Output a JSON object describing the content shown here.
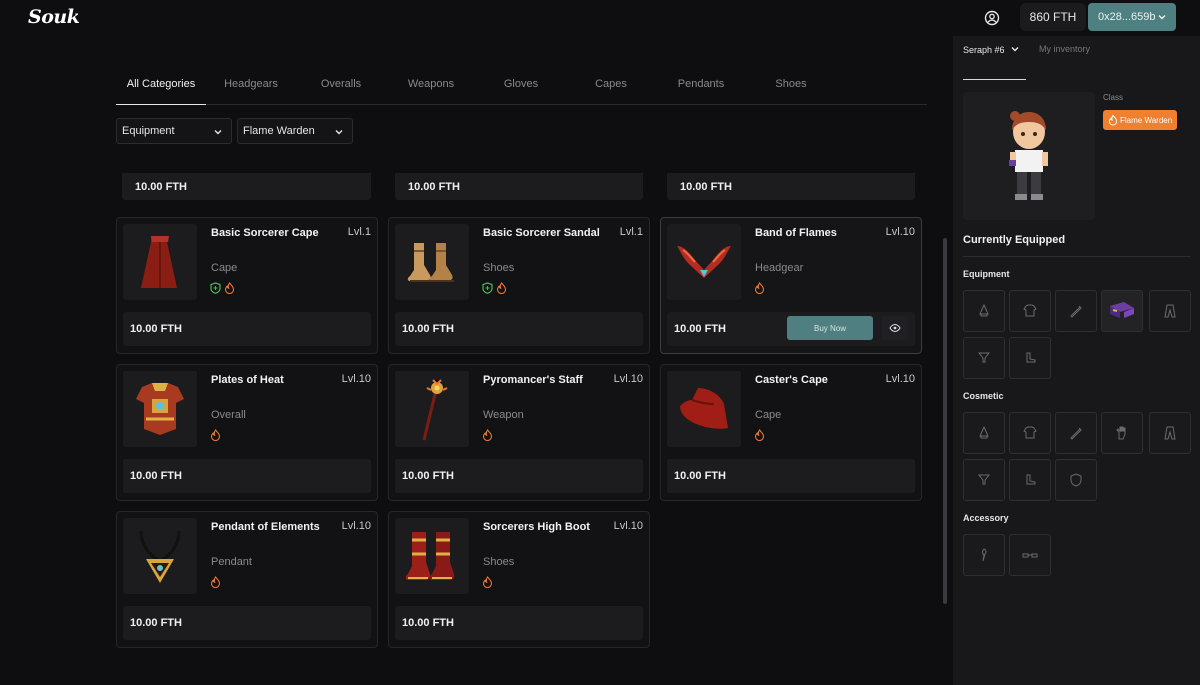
{
  "header": {
    "logo": "Souk",
    "balance": "860 FTH",
    "wallet": "0x28...659b"
  },
  "categories": {
    "tabs": [
      {
        "label": "All Categories",
        "active": true
      },
      {
        "label": "Headgears"
      },
      {
        "label": "Overalls"
      },
      {
        "label": "Weapons"
      },
      {
        "label": "Gloves"
      },
      {
        "label": "Capes"
      },
      {
        "label": "Pendants"
      },
      {
        "label": "Shoes"
      }
    ]
  },
  "filters": {
    "type": "Equipment",
    "class": "Flame Warden"
  },
  "partial_prices": [
    "10.00 FTH",
    "10.00 FTH",
    "10.00 FTH"
  ],
  "items": [
    {
      "name": "Basic Sorcerer Cape",
      "level": "Lvl.1",
      "type": "Cape",
      "price": "10.00 FTH",
      "icon": "red-cape-icon"
    },
    {
      "name": "Basic Sorcerer Sandal",
      "level": "Lvl.1",
      "type": "Shoes",
      "price": "10.00 FTH",
      "icon": "sandal-icon"
    },
    {
      "name": "Band of Flames",
      "level": "Lvl.10",
      "type": "Headgear",
      "price": "10.00 FTH",
      "icon": "flame-band-icon",
      "buy_label": "Buy Now"
    },
    {
      "name": "Plates of Heat",
      "level": "Lvl.10",
      "type": "Overall",
      "price": "10.00 FTH",
      "icon": "armor-icon"
    },
    {
      "name": "Pyromancer's Staff",
      "level": "Lvl.10",
      "type": "Weapon",
      "price": "10.00 FTH",
      "icon": "staff-icon"
    },
    {
      "name": "Caster's Cape",
      "level": "Lvl.10",
      "type": "Cape",
      "price": "10.00 FTH",
      "icon": "cape-icon"
    },
    {
      "name": "Pendant of Elements",
      "level": "Lvl.10",
      "type": "Pendant",
      "price": "10.00 FTH",
      "icon": "pendant-icon"
    },
    {
      "name": "Sorcerers High Boot",
      "level": "Lvl.10",
      "type": "Shoes",
      "price": "10.00 FTH",
      "icon": "boot-icon"
    }
  ],
  "panel": {
    "character": "Seraph #6",
    "inventory_tab": "My inventory",
    "class_label": "Class",
    "class_value": "Flame Warden",
    "currently_equipped": "Currently Equipped",
    "sections": {
      "equipment": "Equipment",
      "cosmetic": "Cosmetic",
      "accessory": "Accessory"
    }
  },
  "colors": {
    "accent": "#4e7f81",
    "class_badge": "#f07f2e",
    "fire": "#f0782a",
    "shield": "#3fbf4f"
  }
}
